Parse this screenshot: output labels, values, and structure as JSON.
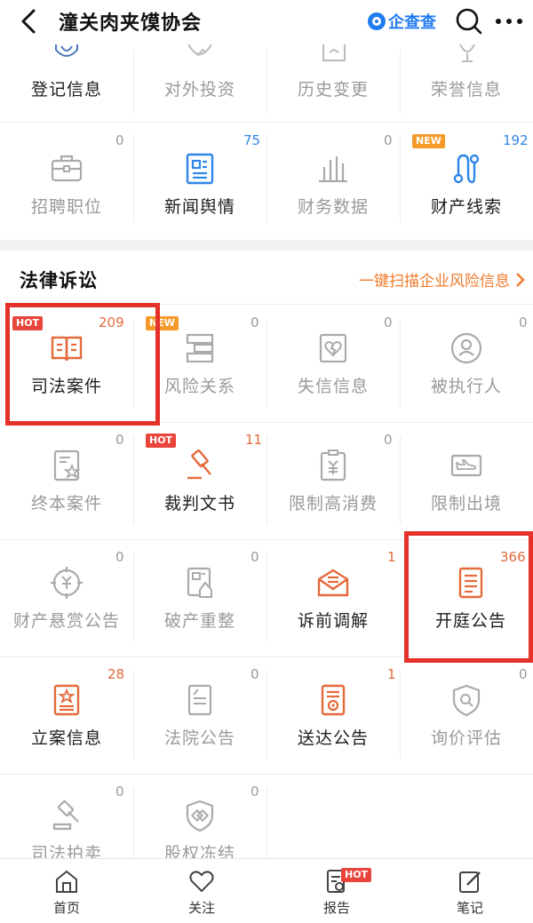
{
  "header": {
    "title": "潼关肉夹馍协会",
    "brand": "企查查"
  },
  "top_row": [
    {
      "label": "登记信息",
      "style": "dark",
      "icon": "shield-icon"
    },
    {
      "label": "对外投资",
      "style": "dim",
      "icon": "investment-chart-icon"
    },
    {
      "label": "历史变更",
      "style": "dim",
      "icon": "history-change-icon"
    },
    {
      "label": "荣誉信息",
      "style": "dim",
      "icon": "trophy-icon"
    }
  ],
  "second_row": [
    {
      "label": "招聘职位",
      "style": "dim",
      "count": "0",
      "icon": "briefcase-icon"
    },
    {
      "label": "新闻舆情",
      "style": "dark",
      "count": "75",
      "icon": "news-icon"
    },
    {
      "label": "财务数据",
      "style": "dim",
      "count": "0",
      "icon": "bar-chart-icon"
    },
    {
      "label": "财产线索",
      "style": "dark",
      "count": "192",
      "tag": "NEW",
      "icon": "property-clue-icon"
    }
  ],
  "section": {
    "title": "法律诉讼",
    "link": "一键扫描企业风险信息"
  },
  "legal_rows": [
    [
      {
        "label": "司法案件",
        "style": "dark",
        "count": "209",
        "tag": "HOT",
        "icon": "judicial-case-book-icon"
      },
      {
        "label": "风险关系",
        "style": "dim",
        "count": "0",
        "tag": "NEW",
        "icon": "risk-relation-icon"
      },
      {
        "label": "失信信息",
        "style": "dim",
        "count": "0",
        "icon": "broken-heart-icon"
      },
      {
        "label": "被执行人",
        "style": "dim",
        "count": "0",
        "icon": "person-circle-icon"
      }
    ],
    [
      {
        "label": "终本案件",
        "style": "dim",
        "count": "0",
        "icon": "case-star-icon"
      },
      {
        "label": "裁判文书",
        "style": "dark",
        "count": "11",
        "tag": "HOT",
        "icon": "gavel-icon"
      },
      {
        "label": "限制高消费",
        "style": "dim",
        "count": "0",
        "icon": "yuan-document-icon"
      },
      {
        "label": "限制出境",
        "style": "dim",
        "count": "",
        "icon": "airplane-icon"
      }
    ],
    [
      {
        "label": "财产悬赏公告",
        "style": "dim",
        "count": "0",
        "icon": "yuan-target-icon"
      },
      {
        "label": "破产重整",
        "style": "dim",
        "count": "0",
        "icon": "bankruptcy-icon"
      },
      {
        "label": "诉前调解",
        "style": "dark",
        "count": "1",
        "icon": "mail-mediation-icon"
      },
      {
        "label": "开庭公告",
        "style": "dark",
        "count": "366",
        "icon": "notice-list-icon"
      }
    ],
    [
      {
        "label": "立案信息",
        "style": "dark",
        "count": "28",
        "icon": "filing-star-icon"
      },
      {
        "label": "法院公告",
        "style": "dim",
        "count": "0",
        "icon": "court-notice-icon"
      },
      {
        "label": "送达公告",
        "style": "dark",
        "count": "1",
        "icon": "delivery-notice-icon"
      },
      {
        "label": "询价评估",
        "style": "dim",
        "count": "0",
        "icon": "shield-search-icon"
      }
    ],
    [
      {
        "label": "司法拍卖",
        "style": "dim",
        "count": "0",
        "icon": "auction-hammer-icon"
      },
      {
        "label": "股权冻结",
        "style": "dim",
        "count": "0",
        "icon": "equity-freeze-icon"
      }
    ]
  ],
  "tabbar": [
    {
      "label": "首页",
      "icon": "home-icon"
    },
    {
      "label": "关注",
      "icon": "heart-icon"
    },
    {
      "label": "报告",
      "icon": "report-icon",
      "tag": "HOT"
    },
    {
      "label": "笔记",
      "icon": "note-edit-icon"
    }
  ],
  "colors": {
    "accent_orange": "#e46a3b",
    "blue": "#2f86e8",
    "highlight_red": "#e4312a",
    "hot_tag": "#e8453c",
    "new_tag": "#f59b2c"
  }
}
